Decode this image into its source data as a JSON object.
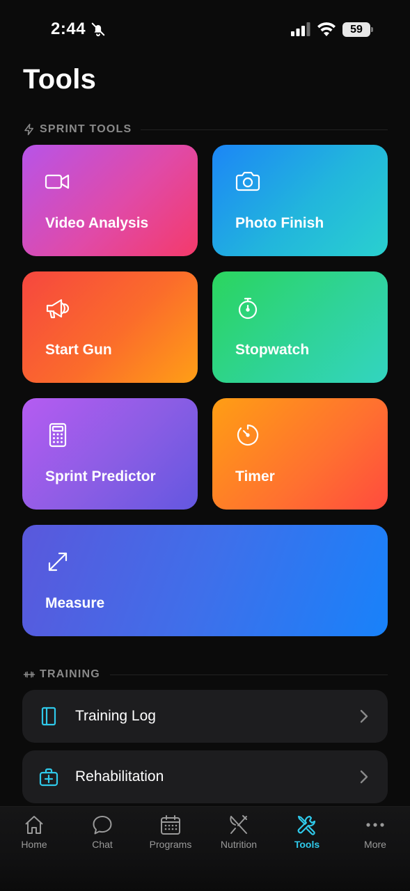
{
  "status_bar": {
    "time": "2:44",
    "battery": "59"
  },
  "page": {
    "title": "Tools"
  },
  "sections": {
    "sprint_tools": "SPRINT TOOLS",
    "training": "TRAINING"
  },
  "tools": {
    "video_analysis": "Video Analysis",
    "photo_finish": "Photo Finish",
    "start_gun": "Start Gun",
    "stopwatch": "Stopwatch",
    "sprint_predictor": "Sprint Predictor",
    "timer": "Timer",
    "measure": "Measure"
  },
  "training_items": {
    "training_log": "Training Log",
    "rehabilitation": "Rehabilitation"
  },
  "tab_bar": {
    "home": "Home",
    "chat": "Chat",
    "programs": "Programs",
    "nutrition": "Nutrition",
    "tools": "Tools",
    "more": "More",
    "active": "Tools"
  },
  "colors": {
    "accent": "#2fc9ea",
    "background": "#0b0b0b",
    "row_background": "#1d1d1f"
  },
  "icons": {
    "video_analysis": "video-camera-icon",
    "photo_finish": "camera-icon",
    "start_gun": "megaphone-icon",
    "stopwatch": "stopwatch-icon",
    "sprint_predictor": "calculator-icon",
    "timer": "timer-icon",
    "measure": "expand-arrows-icon",
    "training_log": "notebook-icon",
    "rehabilitation": "medical-kit-icon"
  }
}
